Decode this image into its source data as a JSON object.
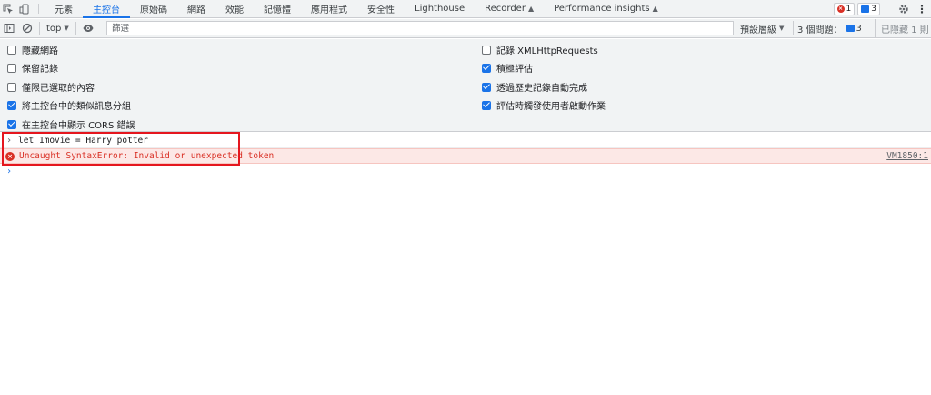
{
  "tabs": [
    "元素",
    "主控台",
    "原始碼",
    "網路",
    "效能",
    "記憶體",
    "應用程式",
    "安全性",
    "Lighthouse",
    "Recorder",
    "Performance insights"
  ],
  "active_tab": "主控台",
  "badges": {
    "errors": "1",
    "messages": "3"
  },
  "toolbar": {
    "context": "top",
    "filter_placeholder": "篩選",
    "levels": "預設層級",
    "issues_label": "3 個問題：",
    "issues_count": "3",
    "hidden": "已隱藏 1 則"
  },
  "settings": {
    "left": [
      {
        "label": "隱藏網路",
        "checked": false
      },
      {
        "label": "保留記錄",
        "checked": false
      },
      {
        "label": "僅限已選取的內容",
        "checked": false
      },
      {
        "label": "將主控台中的類似訊息分組",
        "checked": true
      },
      {
        "label": "在主控台中顯示 CORS 錯誤",
        "checked": true
      }
    ],
    "right": [
      {
        "label": "記錄 XMLHttpRequests",
        "checked": false
      },
      {
        "label": "積極評估",
        "checked": true
      },
      {
        "label": "透過歷史記錄自動完成",
        "checked": true
      },
      {
        "label": "評估時觸發使用者啟動作業",
        "checked": true
      }
    ]
  },
  "console": {
    "command": "let 1movie = Harry potter",
    "error": "Uncaught SyntaxError: Invalid or unexpected token",
    "source": "VM1850:1"
  },
  "colors": {
    "accent": "#1a73e8",
    "error": "#d93025",
    "highlight": "#e5161e"
  }
}
